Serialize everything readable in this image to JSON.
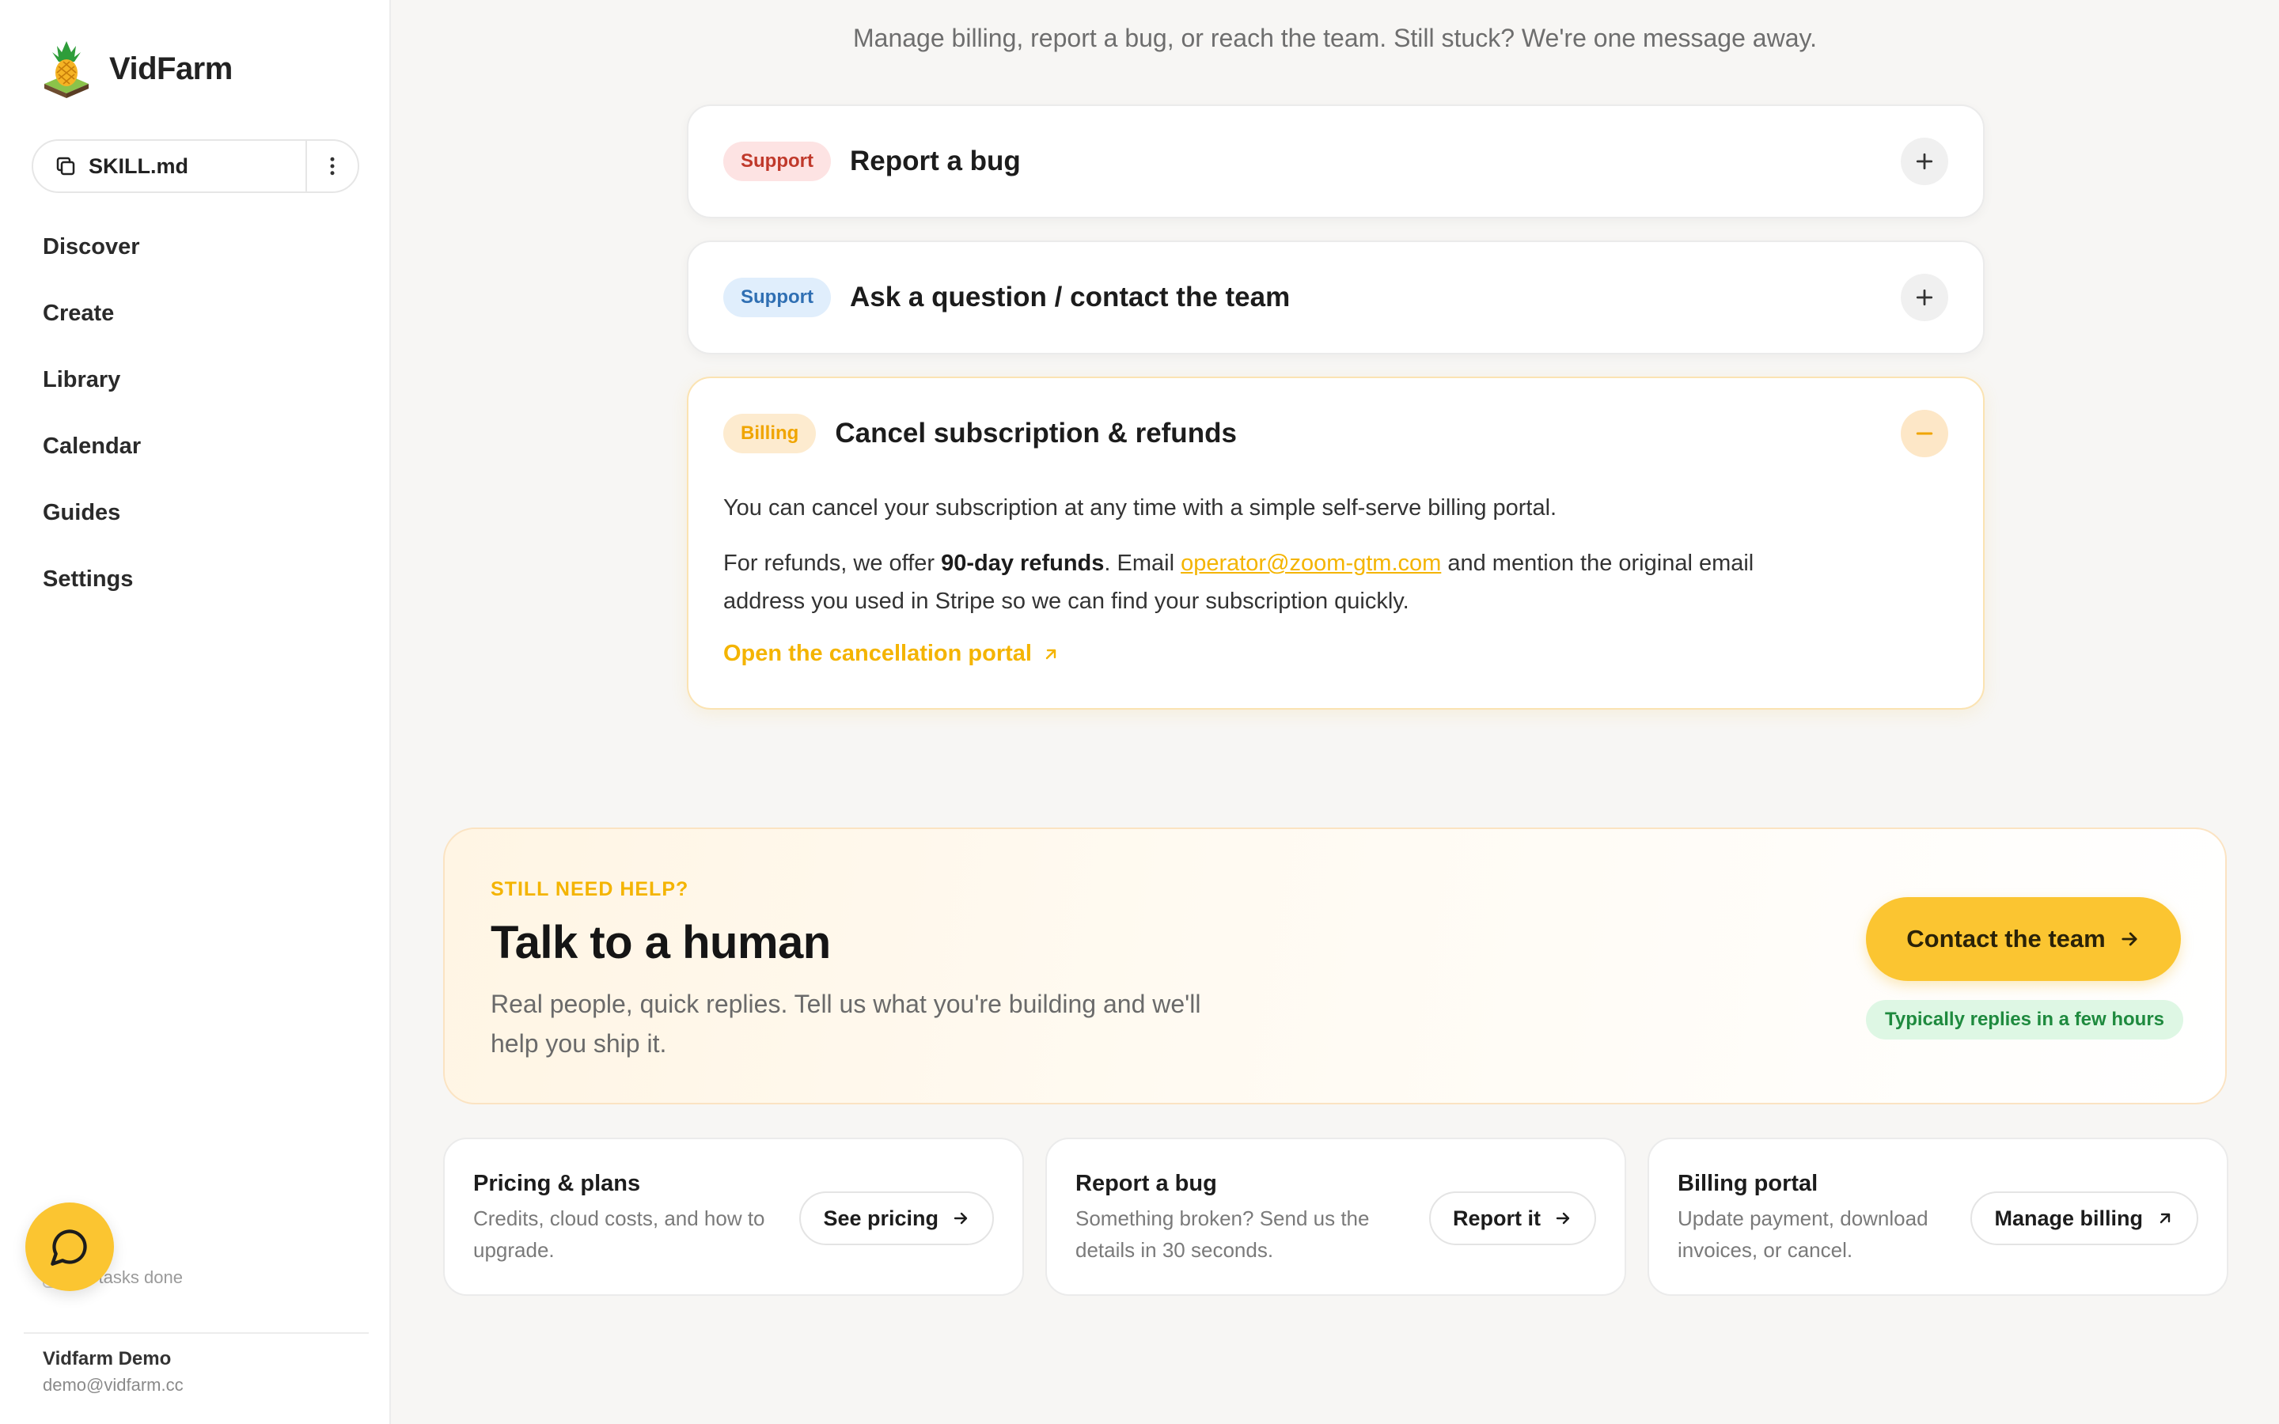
{
  "brand": {
    "name": "VidFarm"
  },
  "sidebar": {
    "skill": {
      "label": "SKILL.md"
    },
    "nav": [
      {
        "label": "Discover"
      },
      {
        "label": "Create"
      },
      {
        "label": "Library"
      },
      {
        "label": "Calendar"
      },
      {
        "label": "Guides"
      },
      {
        "label": "Settings"
      }
    ],
    "tasks_label": "All tasks done",
    "user": {
      "name": "Vidfarm Demo",
      "email": "demo@vidfarm.cc"
    }
  },
  "header": {
    "subtitle": "Manage billing, report a bug, or reach the team. Still stuck? We're one message away."
  },
  "faq": [
    {
      "tag": "Support",
      "title": "Report a bug",
      "expanded": false
    },
    {
      "tag": "Support",
      "title": "Ask a question / contact the team",
      "expanded": false
    },
    {
      "tag": "Billing",
      "title": "Cancel subscription & refunds",
      "expanded": true,
      "body1": "You can cancel your subscription at any time with a simple self-serve billing portal.",
      "body2_prefix": "For refunds, we offer ",
      "body2_bold": "90-day refunds",
      "body2_mid": ". Email ",
      "email": "operator@zoom-gtm.com",
      "body2_suffix": " and mention the original email address you used in Stripe so we can find your subscription quickly.",
      "link": "Open the cancellation portal"
    }
  ],
  "cta": {
    "eyebrow": "STILL NEED HELP?",
    "title": "Talk to a human",
    "text": "Real people, quick replies. Tell us what you're building and we'll help you ship it.",
    "button": "Contact the team",
    "badge": "Typically replies in a few hours"
  },
  "cards": [
    {
      "title": "Pricing & plans",
      "desc": "Credits, cloud costs, and how to upgrade.",
      "button": "See pricing",
      "icon": "arrow-right-icon"
    },
    {
      "title": "Report a bug",
      "desc": "Something broken? Send us the details in 30 seconds.",
      "button": "Report it",
      "icon": "arrow-right-icon"
    },
    {
      "title": "Billing portal",
      "desc": "Update payment, download invoices, or cancel.",
      "button": "Manage billing",
      "icon": "external-link-icon"
    }
  ],
  "colors": {
    "accent": "#fbc531",
    "accent_text": "#f4b400",
    "support_red": "#c0392b",
    "support_blue": "#2f6fb3",
    "success_green": "#1e8a3e"
  }
}
